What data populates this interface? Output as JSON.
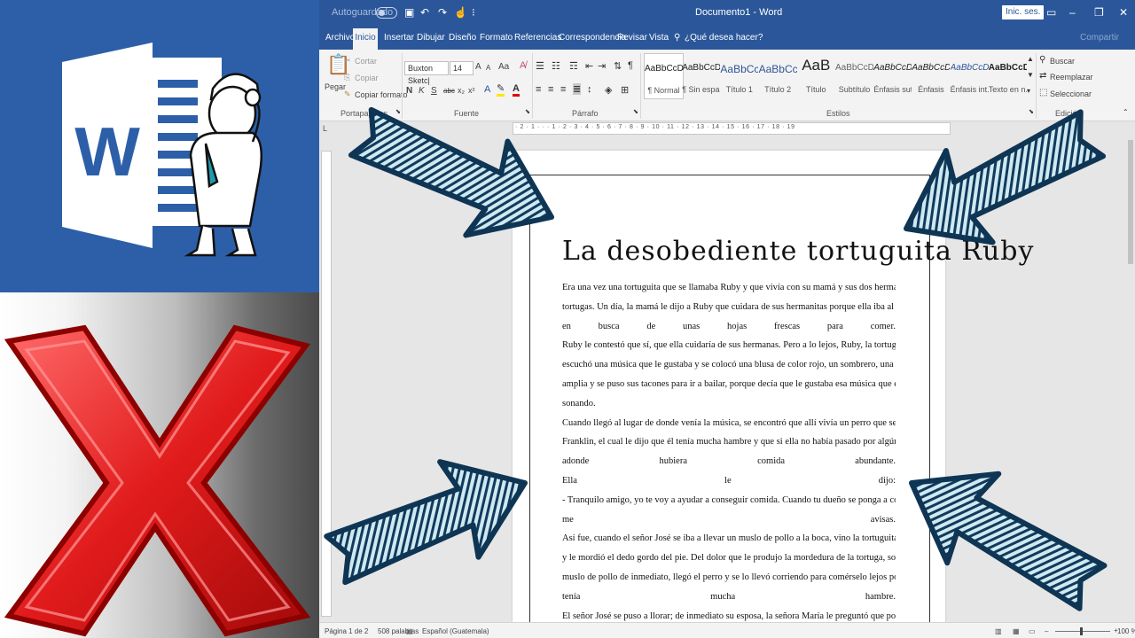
{
  "titlebar": {
    "autosave_label": "Autoguardado",
    "title": "Documento1 - Word",
    "signin_label": "Inic. ses."
  },
  "tabs": [
    "Archivo",
    "Inicio",
    "Insertar",
    "Dibujar",
    "Diseño",
    "Formato",
    "Referencias",
    "Correspondencia",
    "Revisar",
    "Vista"
  ],
  "tell_me": "¿Qué desea hacer?",
  "share_label": "Compartir",
  "ribbon": {
    "clipboard": {
      "paste": "Pegar",
      "cut": "Cortar",
      "copy": "Copiar",
      "format_painter": "Copiar formato",
      "group": "Portapapeles"
    },
    "font": {
      "name": "Buxton Sketc|",
      "size": "14",
      "group": "Fuente",
      "bold": "N",
      "italic": "K",
      "underline": "S",
      "strike": "abc",
      "subscript": "x₂",
      "superscript": "x²",
      "grow": "A",
      "shrink": "A",
      "case": "Aa"
    },
    "paragraph": {
      "group": "Párrafo"
    },
    "styles": {
      "group": "Estilos",
      "items": [
        {
          "preview": "AaBbCcDd",
          "name": "¶ Normal"
        },
        {
          "preview": "AaBbCcDd",
          "name": "¶ Sin espa..."
        },
        {
          "preview": "AaBbCc",
          "name": "Título 1"
        },
        {
          "preview": "AaBbCcC",
          "name": "Título 2"
        },
        {
          "preview": "AaB",
          "name": "Título"
        },
        {
          "preview": "AaBbCcD",
          "name": "Subtítulo"
        },
        {
          "preview": "AaBbCcDd",
          "name": "Énfasis sutil"
        },
        {
          "preview": "AaBbCcDd",
          "name": "Énfasis"
        },
        {
          "preview": "AaBbCcDd",
          "name": "Énfasis int..."
        },
        {
          "preview": "AaBbCcDc",
          "name": "Texto en n..."
        }
      ]
    },
    "editing": {
      "group": "Edición",
      "find": "Buscar",
      "replace": "Reemplazar",
      "select": "Seleccionar"
    }
  },
  "ruler_numbers": "· 2 · 1 · · · 1 · 2 · 3 · 4 · 5 · 6 · 7 · 8 · 9 · 10 · 11 · 12 · 13 · 14 · 15 · 16 · 17 · 18 · 19",
  "document": {
    "title": "La desobediente tortuguita Ruby",
    "lines": [
      "Era una vez una tortuguita que se llamaba Ruby y que vivía con su mamá y sus dos hermanitas",
      "tortugas. Un día, la mamá le dijo a Ruby que cuidara de sus hermanitas porque ella iba al campo",
      "en busca de unas hojas frescas para comer.",
      "Ruby le contestó que sí, que ella cuidaría de sus hermanas. Pero a lo lejos, Ruby, la tortuguita,",
      "escuchó una música que le gustaba y se colocó una blusa de color rojo, un sombrero, una falda",
      "amplia y se puso sus tacones para ir a bailar, porque decía que le gustaba esa música que estaba",
      "sonando.",
      "Cuando llegó al lugar de donde venía la música, se encontró que allí vivía un perro que se llamaba",
      "Franklin, el cual le dijo que él tenía mucha hambre y que si ella no había pasado por algún lugar",
      "adonde hubiera comida abundante.",
      "Ella le dijo:",
      "- Tranquilo amigo, yo te voy a ayudar a conseguir comida. Cuando tu dueño se ponga a comer",
      "me avisas.",
      "Así fue, cuando el señor José se iba a llevar un muslo de pollo a la boca, vino la tortuguita Ruby",
      "y le mordió el dedo gordo del pie. Del dolor que le produjo la mordedura de la tortuga, soltó el",
      "muslo de pollo de inmediato, llegó el perro y se lo llevó corriendo para comérselo lejos porque",
      "tenía mucha hambre.",
      "El señor José se puso a llorar; de inmediato su esposa, la señora María le preguntó que por qué"
    ]
  },
  "status": {
    "page": "Página 1 de 2",
    "words": "508 palabras",
    "language": "Español (Guatemala)",
    "zoom": "100 %"
  },
  "accent": "#2b579a"
}
